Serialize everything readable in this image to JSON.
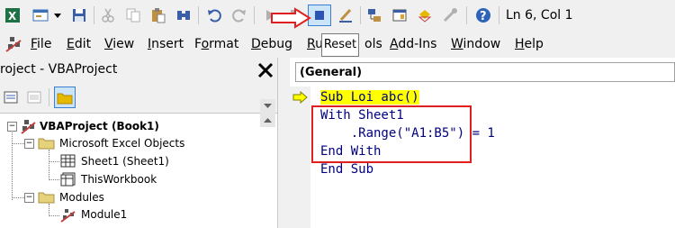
{
  "status": {
    "position": "Ln 6, Col 1"
  },
  "toolbar": {
    "reset_tooltip": "Reset",
    "icons": [
      "excel-icon",
      "insert-userform-icon",
      "dropdown-icon",
      "save-icon",
      "cut-icon",
      "copy-icon",
      "paste-icon",
      "find-icon",
      "undo-icon",
      "redo-icon",
      "run-icon",
      "break-icon",
      "reset-icon",
      "design-mode-icon",
      "project-explorer-icon",
      "properties-icon",
      "object-browser-icon",
      "toolbox-icon",
      "help-icon"
    ]
  },
  "menu": {
    "items": [
      {
        "label": "File",
        "underline": "F",
        "rest": "ile"
      },
      {
        "label": "Edit",
        "underline": "E",
        "rest": "dit"
      },
      {
        "label": "View",
        "underline": "V",
        "rest": "iew"
      },
      {
        "label": "Insert",
        "underline": "I",
        "rest": "nsert"
      },
      {
        "label": "Format",
        "underline": "o",
        "pre": "F",
        "rest": "rmat"
      },
      {
        "label": "Debug",
        "underline": "D",
        "rest": "ebug"
      },
      {
        "label": "Run",
        "underline": "R",
        "rest": "u"
      },
      {
        "label": "Tools",
        "visible": "ols"
      },
      {
        "label": "Add-Ins",
        "underline": "A",
        "rest": "dd-Ins"
      },
      {
        "label": "Window",
        "underline": "W",
        "rest": "indow"
      },
      {
        "label": "Help",
        "underline": "H",
        "rest": "elp"
      }
    ]
  },
  "project": {
    "title": "roject - VBAProject",
    "close": "✕",
    "tree": {
      "root": "VBAProject (Book1)",
      "excel_objects": "Microsoft Excel Objects",
      "sheet1": "Sheet1 (Sheet1)",
      "thisworkbook": "ThisWorkbook",
      "modules": "Modules",
      "module1": "Module1"
    }
  },
  "code": {
    "object_combo": "(General)",
    "lines": [
      "Sub Loi abc()",
      "With Sheet1",
      "    .Range(\"A1:B5\") = 1",
      "End With",
      "End Sub"
    ]
  },
  "colors": {
    "annotation_red": "#e02020",
    "highlight": "#ffff00",
    "code_blue": "#000080"
  }
}
